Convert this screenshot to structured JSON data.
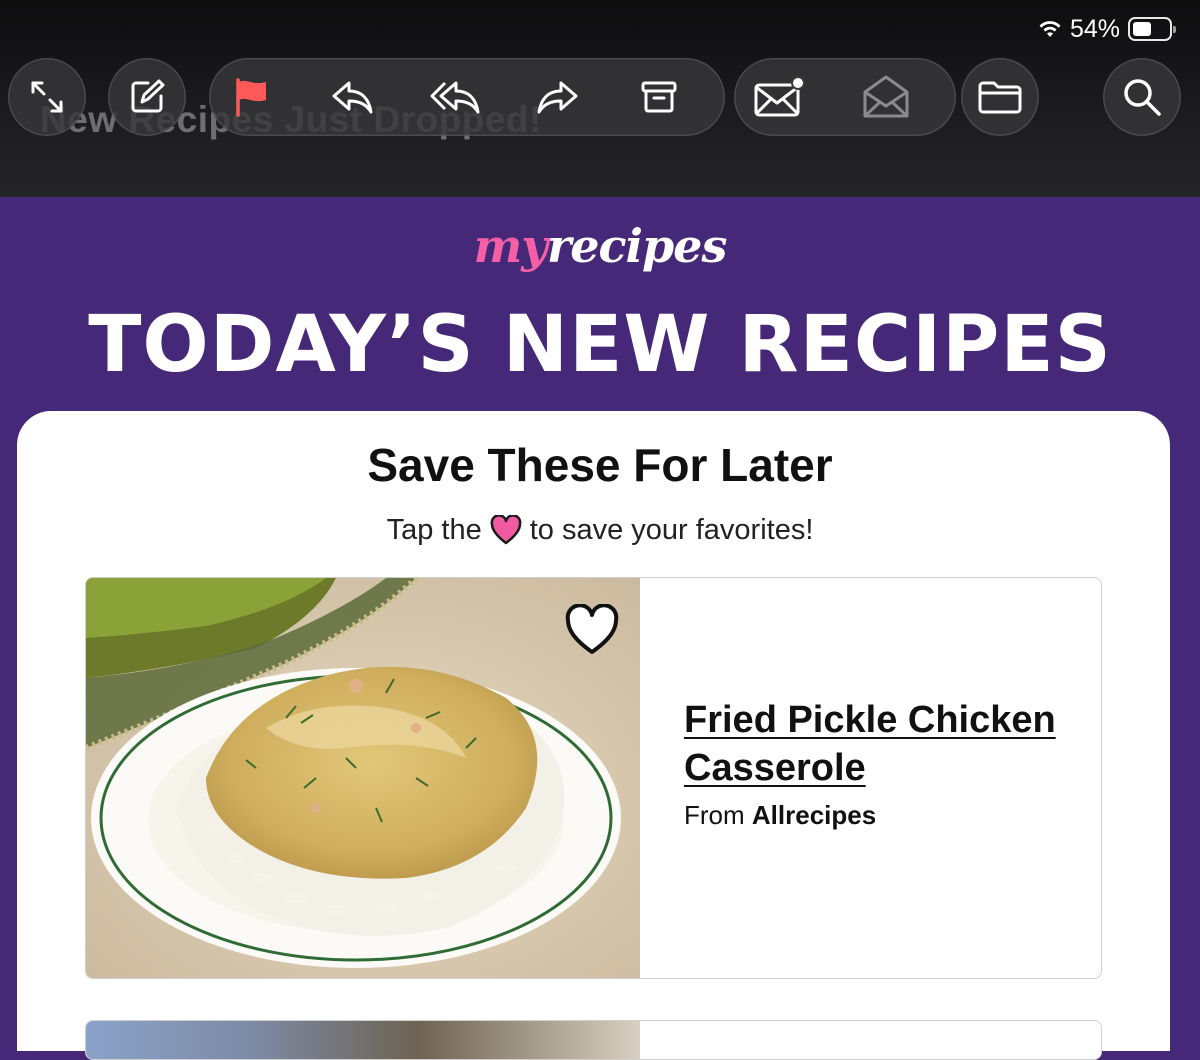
{
  "status_bar": {
    "battery_percent": "54%",
    "battery_level": 0.54,
    "wifi": "wifi-icon"
  },
  "mail": {
    "subject_ghost": "New Recipes Just Dropped!"
  },
  "toolbar": {
    "buttons": [
      {
        "name": "expand-button",
        "icon": "expand-arrows-icon"
      },
      {
        "name": "compose-button",
        "icon": "compose-icon"
      },
      {
        "name": "flag-button",
        "icon": "flag-icon",
        "color": "#ff5a5a"
      },
      {
        "name": "reply-button",
        "icon": "reply-icon"
      },
      {
        "name": "reply-all-button",
        "icon": "reply-all-icon"
      },
      {
        "name": "forward-button",
        "icon": "forward-icon"
      },
      {
        "name": "archive-button",
        "icon": "archive-box-icon"
      },
      {
        "name": "mark-unread-button",
        "icon": "envelope-badge-icon"
      },
      {
        "name": "mark-read-button",
        "icon": "open-envelope-icon"
      },
      {
        "name": "move-folder-button",
        "icon": "folder-icon"
      },
      {
        "name": "search-button",
        "icon": "search-icon"
      }
    ]
  },
  "email": {
    "logo_my": "my",
    "logo_rest": "recipes",
    "headline": "TODAY’S NEW RECIPES",
    "section_title": "Save These For Later",
    "tap_prefix": "Tap the",
    "tap_suffix": "to save your favorites!",
    "recipes": [
      {
        "title": "Fried Pickle Chicken Casserole",
        "from_label": "From",
        "source": "Allrecipes"
      }
    ]
  },
  "colors": {
    "brand_purple": "#452878",
    "brand_pink": "#f45fa6",
    "chrome_dark": "#1c1c1e"
  }
}
